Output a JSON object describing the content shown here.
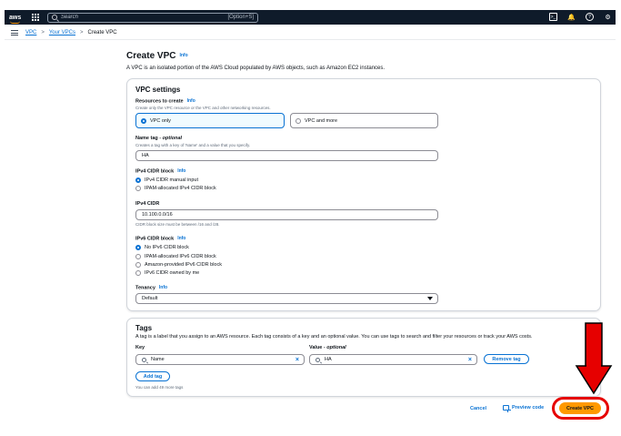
{
  "nav": {
    "logo": "aws",
    "search_placeholder": "Search",
    "search_shortcut": "[Option+S]",
    "icons": [
      "cloudshell-icon",
      "bell-icon",
      "help-icon",
      "gear-icon"
    ]
  },
  "breadcrumb": {
    "items": [
      "VPC",
      "Your VPCs",
      "Create VPC"
    ]
  },
  "page": {
    "title": "Create VPC",
    "info": "Info",
    "description": "A VPC is an isolated portion of the AWS Cloud populated by AWS objects, such as Amazon EC2 instances."
  },
  "vpc_settings": {
    "heading": "VPC settings",
    "resources": {
      "label": "Resources to create",
      "info": "Info",
      "description": "Create only the VPC resource or the VPC and other networking resources.",
      "options": [
        "VPC only",
        "VPC and more"
      ],
      "selected": "VPC only"
    },
    "name_tag": {
      "label": "Name tag",
      "optional": "- optional",
      "description": "Creates a tag with a key of 'Name' and a value that you specify.",
      "value": "HA"
    },
    "ipv4_block": {
      "label": "IPv4 CIDR block",
      "info": "Info",
      "options": [
        "IPv4 CIDR manual input",
        "IPAM-allocated IPv4 CIDR block"
      ],
      "selected": "IPv4 CIDR manual input"
    },
    "ipv4_cidr": {
      "label": "IPv4 CIDR",
      "value": "10.100.0.0/16",
      "hint": "CIDR block size must be between /16 and /28."
    },
    "ipv6_block": {
      "label": "IPv6 CIDR block",
      "info": "Info",
      "options": [
        "No IPv6 CIDR block",
        "IPAM-allocated IPv6 CIDR block",
        "Amazon-provided IPv6 CIDR block",
        "IPv6 CIDR owned by me"
      ],
      "selected": "No IPv6 CIDR block"
    },
    "tenancy": {
      "label": "Tenancy",
      "info": "Info",
      "value": "Default"
    }
  },
  "tags": {
    "heading": "Tags",
    "description": "A tag is a label that you assign to an AWS resource. Each tag consists of a key and an optional value. You can use tags to search and filter your resources or track your AWS costs.",
    "key_label": "Key",
    "value_label": "Value",
    "value_optional": "- optional",
    "key_value": "Name",
    "value_value": "HA",
    "remove_label": "Remove tag",
    "add_label": "Add tag",
    "limit_text": "You can add 49 more tags"
  },
  "actions": {
    "cancel": "Cancel",
    "preview": "Preview code",
    "create": "Create VPC"
  },
  "colors": {
    "nav_bg": "#0f1b2a",
    "link": "#0972d3",
    "primary_button": "#ff9900",
    "annotation": "#e60000"
  }
}
